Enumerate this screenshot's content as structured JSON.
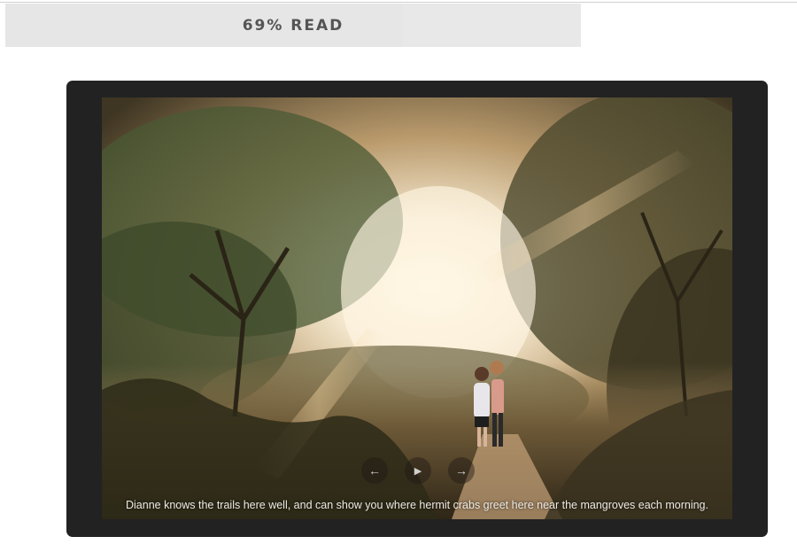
{
  "progress": {
    "label": "69% READ",
    "fraction": 0.69
  },
  "gallery": {
    "prev_icon": "arrow-left-icon",
    "play_icon": "play-icon",
    "next_icon": "arrow-right-icon",
    "caption": "Dianne knows the trails here well, and can show you where hermit crabs greet here near the mangroves each morning."
  },
  "colors": {
    "frame": "#222222",
    "progress_bg": "#e8e8e8",
    "progress_text": "#555555"
  }
}
